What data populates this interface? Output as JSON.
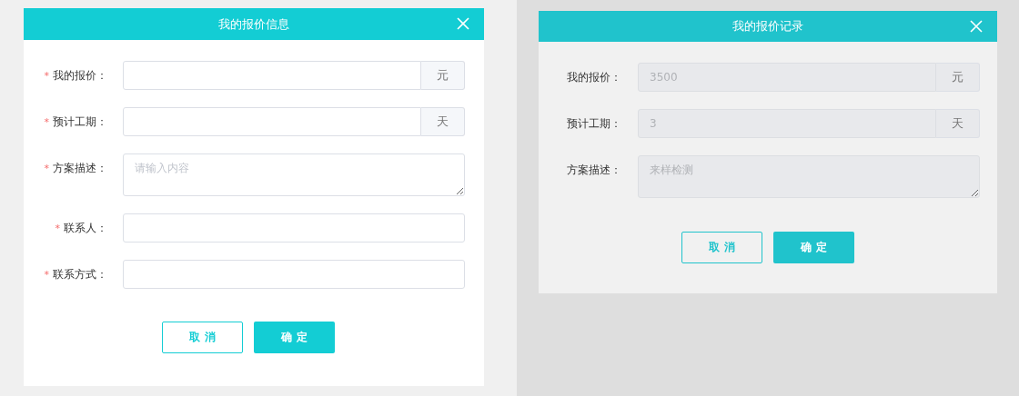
{
  "dialogs": [
    {
      "title": "我的报价信息",
      "fields": [
        {
          "marker": "*",
          "label": "我的报价：",
          "kind": "input",
          "unit": "元",
          "disabled": false
        },
        {
          "marker": "*",
          "label": "预计工期：",
          "kind": "input",
          "unit": "天",
          "disabled": false
        },
        {
          "marker": "*",
          "label": "方案描述：",
          "kind": "textarea",
          "placeholder": "请输入内容",
          "disabled": false
        },
        {
          "marker": "*",
          "label": "联系人：",
          "kind": "input",
          "disabled": false
        },
        {
          "marker": "*",
          "label": "联系方式：",
          "kind": "input",
          "disabled": false
        }
      ],
      "buttons": [
        {
          "label": "取 消",
          "kind": "secondary"
        },
        {
          "label": "确 定",
          "kind": "primary"
        }
      ]
    },
    {
      "title": "我的报价记录",
      "fields": [
        {
          "label": "我的报价：",
          "kind": "input",
          "unit": "元",
          "value": "3500",
          "disabled": true
        },
        {
          "label": "预计工期：",
          "kind": "input",
          "unit": "天",
          "value": "3",
          "disabled": true
        },
        {
          "label": "方案描述：",
          "kind": "textarea",
          "value": "来样检测",
          "disabled": true
        }
      ],
      "buttons": [
        {
          "label": "取 消",
          "kind": "secondary"
        },
        {
          "label": "确 定",
          "kind": "primary"
        }
      ]
    }
  ]
}
